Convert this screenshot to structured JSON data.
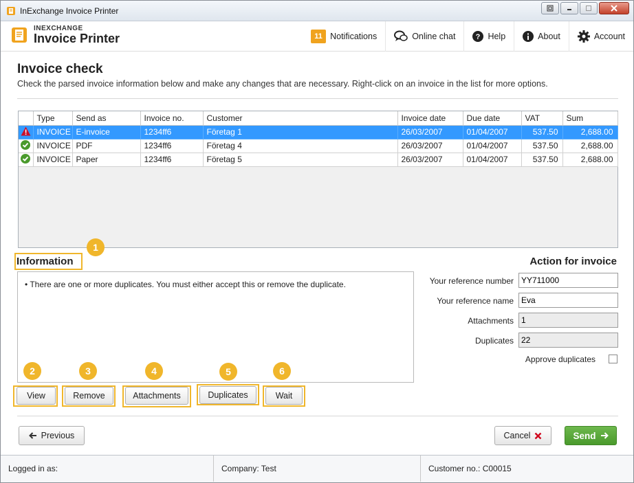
{
  "window": {
    "title": "InExchange Invoice Printer"
  },
  "header": {
    "brand_small": "INEXCHANGE",
    "brand_big": "Invoice Printer",
    "nav": {
      "notifications_count": "11",
      "notifications": "Notifications",
      "online_chat": "Online chat",
      "help": "Help",
      "about": "About",
      "account": "Account"
    }
  },
  "page": {
    "title": "Invoice check",
    "subtitle": "Check the parsed invoice information below and make any changes that are necessary. Right-click on an invoice in the list for more options."
  },
  "table": {
    "columns": [
      "",
      "Type",
      "Send as",
      "Invoice no.",
      "Customer",
      "Invoice date",
      "Due date",
      "VAT",
      "Sum"
    ],
    "rows": [
      {
        "status": "error",
        "type": "INVOICE",
        "send_as": "E-invoice",
        "invoice_no": "1234ff6",
        "customer": "Företag 1",
        "invoice_date": "26/03/2007",
        "due_date": "01/04/2007",
        "vat": "537.50",
        "sum": "2,688.00",
        "selected": true
      },
      {
        "status": "ok",
        "type": "INVOICE",
        "send_as": "PDF",
        "invoice_no": "1234ff6",
        "customer": "Företag 4",
        "invoice_date": "26/03/2007",
        "due_date": "01/04/2007",
        "vat": "537.50",
        "sum": "2,688.00",
        "selected": false
      },
      {
        "status": "ok",
        "type": "INVOICE",
        "send_as": "Paper",
        "invoice_no": "1234ff6",
        "customer": "Företag 5",
        "invoice_date": "26/03/2007",
        "due_date": "01/04/2007",
        "vat": "537.50",
        "sum": "2,688.00",
        "selected": false
      }
    ]
  },
  "information": {
    "label": "Information",
    "message": "There are one or more duplicates. You must either accept this or remove the duplicate."
  },
  "action": {
    "title": "Action for invoice",
    "your_reference_number_label": "Your reference number",
    "your_reference_number": "YY711000",
    "your_reference_name_label": "Your reference name",
    "your_reference_name": "Eva",
    "attachments_label": "Attachments",
    "attachments": "1",
    "duplicates_label": "Duplicates",
    "duplicates": "22",
    "approve_duplicates_label": "Approve duplicates",
    "approve_duplicates_checked": false
  },
  "buttons": {
    "view": "View",
    "remove": "Remove",
    "attachments": "Attachments",
    "duplicates": "Duplicates",
    "wait": "Wait",
    "previous": "Previous",
    "cancel": "Cancel",
    "send": "Send"
  },
  "callouts": [
    "1",
    "2",
    "3",
    "4",
    "5",
    "6"
  ],
  "status_bar": {
    "logged_in": "Logged in as:",
    "company": "Company: Test",
    "customer_no": "Customer no.: C00015"
  },
  "colors": {
    "accent": "#f0b62b",
    "selection": "#3399ff",
    "send": "#4a9a2c",
    "cancel_icon": "#d0021b"
  }
}
